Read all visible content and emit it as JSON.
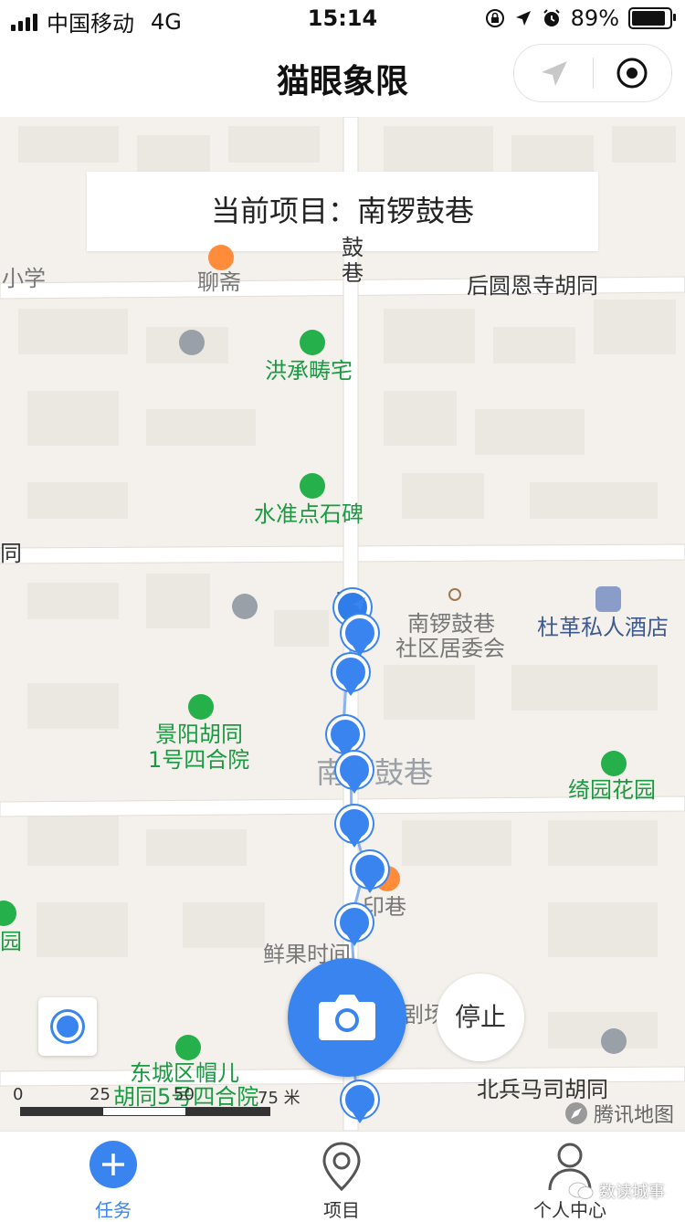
{
  "status": {
    "carrier": "中国移动",
    "network": "4G",
    "time": "15:14",
    "battery": "89%",
    "battery_level": 0.89
  },
  "nav": {
    "title": "猫眼象限"
  },
  "banner": {
    "prefix": "当前项目：",
    "project": "南锣鼓巷"
  },
  "map": {
    "labels": {
      "school": "小学",
      "liaozhai": "聊斋",
      "gu_xiang": "鼓\n巷",
      "houyuan": "后圆恩寺胡同",
      "hongcheng": "洪承畴宅",
      "shuizhun": "水准点石碑",
      "tong_left": "同",
      "nan": "南",
      "committee_1": "南锣鼓巷",
      "committee_2": "社区居委会",
      "dugedu": "杜革私人酒店",
      "jingyang_1": "景阳胡同",
      "jingyang_2": "1号四合院",
      "nanluo_big": "南锣鼓巷",
      "yiyuan": "绮园花园",
      "yinxiang": "印巷",
      "yuan_left": "园",
      "xianguo": "鲜果时间",
      "juchang": "剧场",
      "dongcheng_1": "东城区帽儿",
      "dongcheng_2": "胡同5号四合院",
      "beibing": "北兵马司胡同"
    },
    "scale": {
      "ticks": [
        "0",
        "25",
        "50",
        "75 米"
      ]
    },
    "provider": "腾讯地图",
    "stop_label": "停止"
  },
  "tabs": [
    {
      "label": "任务",
      "icon": "plus-circle-icon",
      "active": true
    },
    {
      "label": "项目",
      "icon": "location-pin-icon",
      "active": false
    },
    {
      "label": "个人中心",
      "icon": "person-icon",
      "active": false
    }
  ],
  "watermark": "数读城事",
  "colors": {
    "accent": "#3a84f0",
    "poi_green": "#1a9a42",
    "map_bg": "#f4f1ec"
  }
}
